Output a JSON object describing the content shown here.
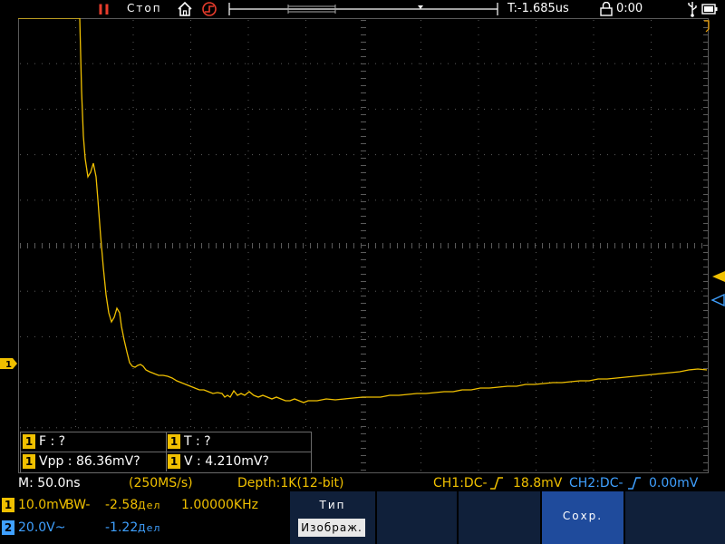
{
  "top_bar": {
    "run_status_icon": "pause-icon",
    "run_status_label": "Стоп",
    "time_offset": "T:-1.685us",
    "elapsed": "0:00"
  },
  "trace": {
    "color": "#f0c000",
    "grid_color": "#5a5a5a",
    "points": [
      [
        0,
        0
      ],
      [
        68,
        0
      ],
      [
        69,
        40
      ],
      [
        70,
        80
      ],
      [
        72,
        130
      ],
      [
        74,
        155
      ],
      [
        77,
        175
      ],
      [
        80,
        170
      ],
      [
        83,
        160
      ],
      [
        86,
        175
      ],
      [
        88,
        200
      ],
      [
        91,
        240
      ],
      [
        94,
        275
      ],
      [
        97,
        305
      ],
      [
        100,
        325
      ],
      [
        103,
        335
      ],
      [
        106,
        330
      ],
      [
        109,
        320
      ],
      [
        112,
        325
      ],
      [
        114,
        340
      ],
      [
        117,
        355
      ],
      [
        120,
        368
      ],
      [
        123,
        380
      ],
      [
        126,
        384
      ],
      [
        129,
        385
      ],
      [
        132,
        383
      ],
      [
        135,
        382
      ],
      [
        138,
        384
      ],
      [
        141,
        388
      ],
      [
        145,
        390
      ],
      [
        150,
        392
      ],
      [
        155,
        394
      ],
      [
        160,
        394
      ],
      [
        165,
        395
      ],
      [
        170,
        397
      ],
      [
        175,
        400
      ],
      [
        180,
        402
      ],
      [
        185,
        404
      ],
      [
        190,
        406
      ],
      [
        195,
        408
      ],
      [
        200,
        410
      ],
      [
        205,
        410
      ],
      [
        210,
        412
      ],
      [
        215,
        414
      ],
      [
        220,
        413
      ],
      [
        225,
        414
      ],
      [
        228,
        418
      ],
      [
        231,
        416
      ],
      [
        234,
        418
      ],
      [
        238,
        411
      ],
      [
        242,
        416
      ],
      [
        246,
        414
      ],
      [
        250,
        416
      ],
      [
        255,
        412
      ],
      [
        260,
        416
      ],
      [
        265,
        418
      ],
      [
        270,
        416
      ],
      [
        275,
        418
      ],
      [
        280,
        420
      ],
      [
        285,
        418
      ],
      [
        290,
        420
      ],
      [
        295,
        422
      ],
      [
        300,
        422
      ],
      [
        305,
        420
      ],
      [
        310,
        422
      ],
      [
        315,
        424
      ],
      [
        320,
        422
      ],
      [
        330,
        422
      ],
      [
        340,
        420
      ],
      [
        350,
        421
      ],
      [
        360,
        420
      ],
      [
        370,
        419
      ],
      [
        380,
        418
      ],
      [
        390,
        418
      ],
      [
        400,
        418
      ],
      [
        410,
        416
      ],
      [
        420,
        416
      ],
      [
        430,
        415
      ],
      [
        440,
        414
      ],
      [
        450,
        414
      ],
      [
        460,
        413
      ],
      [
        470,
        412
      ],
      [
        480,
        412
      ],
      [
        490,
        410
      ],
      [
        500,
        410
      ],
      [
        510,
        408
      ],
      [
        520,
        408
      ],
      [
        530,
        407
      ],
      [
        540,
        406
      ],
      [
        550,
        406
      ],
      [
        560,
        404
      ],
      [
        570,
        404
      ],
      [
        580,
        403
      ],
      [
        590,
        402
      ],
      [
        600,
        402
      ],
      [
        610,
        401
      ],
      [
        620,
        400
      ],
      [
        630,
        400
      ],
      [
        640,
        398
      ],
      [
        650,
        398
      ],
      [
        660,
        397
      ],
      [
        670,
        396
      ],
      [
        680,
        395
      ],
      [
        690,
        394
      ],
      [
        700,
        393
      ],
      [
        710,
        392
      ],
      [
        720,
        391
      ],
      [
        730,
        390
      ],
      [
        740,
        388
      ],
      [
        750,
        387
      ],
      [
        760,
        388
      ]
    ]
  },
  "measurements": {
    "rows": [
      [
        {
          "ch": "1",
          "text": "F :   ?"
        },
        {
          "ch": "1",
          "text": "T :   ?"
        }
      ],
      [
        {
          "ch": "1",
          "text": "Vpp : 86.36mV?"
        },
        {
          "ch": "1",
          "text": "V : 4.210mV?"
        }
      ]
    ]
  },
  "info_row": {
    "timebase": "M: 50.0ns",
    "sample_rate": "(250MS/s)",
    "depth": "Depth:1K(12-bit)",
    "ch1_status": "CH1:DC-",
    "ch1_trigger_level": "18.8mV",
    "ch2_status": "CH2:DC-",
    "ch2_trigger_level": "0.00mV"
  },
  "channels": {
    "ch1": {
      "num": "1",
      "scale": "10.0mV",
      "bw": "BW-",
      "offset": "-2.58",
      "unit": "Дел",
      "freq": "1.00000KHz"
    },
    "ch2": {
      "num": "2",
      "scale": "20.0V~",
      "offset": "-1.22",
      "unit": "Дел"
    }
  },
  "menu": {
    "type_label": "Тип",
    "type_value": "Изображ.",
    "save_label": "Сохр."
  },
  "colors": {
    "ch1": "#f0c000",
    "ch2": "#3fa0ff",
    "accent_button": "#1f4b9c"
  }
}
